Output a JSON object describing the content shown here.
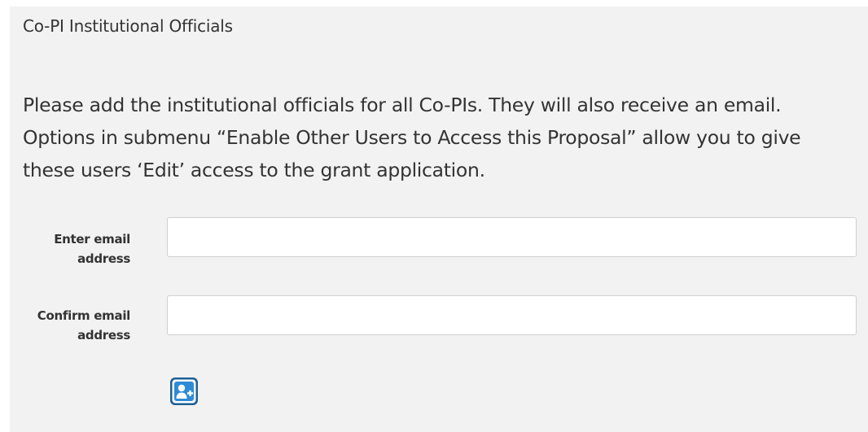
{
  "section": {
    "title": "Co-PI Institutional Officials",
    "instructions": "Please add the institutional officials for all Co-PIs. They will also receive an email. Options in submenu “Enable Other Users to Access this Proposal” allow you to give these users ‘Edit’ access to the grant application."
  },
  "form": {
    "email_label": "Enter email address",
    "email_value": "",
    "confirm_label": "Confirm email address",
    "confirm_value": ""
  },
  "add_button": {
    "icon": "add-user-icon",
    "color": "#2f8bd6",
    "outline_color": "#1f5f94"
  }
}
